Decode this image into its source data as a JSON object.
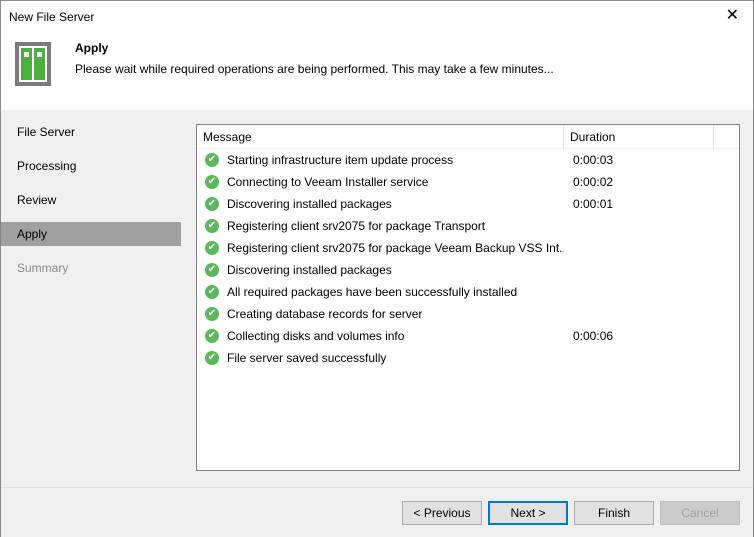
{
  "window": {
    "title": "New File Server",
    "close": "✕"
  },
  "header": {
    "title": "Apply",
    "subtitle": "Please wait while required operations are being performed. This may take a few minutes..."
  },
  "sidebar": {
    "items": [
      {
        "label": "File Server"
      },
      {
        "label": "Processing"
      },
      {
        "label": "Review"
      },
      {
        "label": "Apply"
      },
      {
        "label": "Summary"
      }
    ]
  },
  "log": {
    "columns": [
      "Message",
      "Duration"
    ],
    "rows": [
      {
        "message": "Starting infrastructure item update process",
        "duration": "0:00:03"
      },
      {
        "message": "Connecting to Veeam Installer service",
        "duration": "0:00:02"
      },
      {
        "message": "Discovering installed packages",
        "duration": "0:00:01"
      },
      {
        "message": "Registering client srv2075 for package Transport",
        "duration": ""
      },
      {
        "message": "Registering client srv2075 for package Veeam Backup VSS Int...",
        "duration": ""
      },
      {
        "message": "Discovering installed packages",
        "duration": ""
      },
      {
        "message": "All required packages have been successfully installed",
        "duration": ""
      },
      {
        "message": "Creating database records for server",
        "duration": ""
      },
      {
        "message": "Collecting disks and volumes info",
        "duration": "0:00:06"
      },
      {
        "message": "File server saved successfully",
        "duration": ""
      }
    ]
  },
  "buttons": {
    "previous": "< Previous",
    "next": "Next >",
    "finish": "Finish",
    "cancel": "Cancel"
  }
}
